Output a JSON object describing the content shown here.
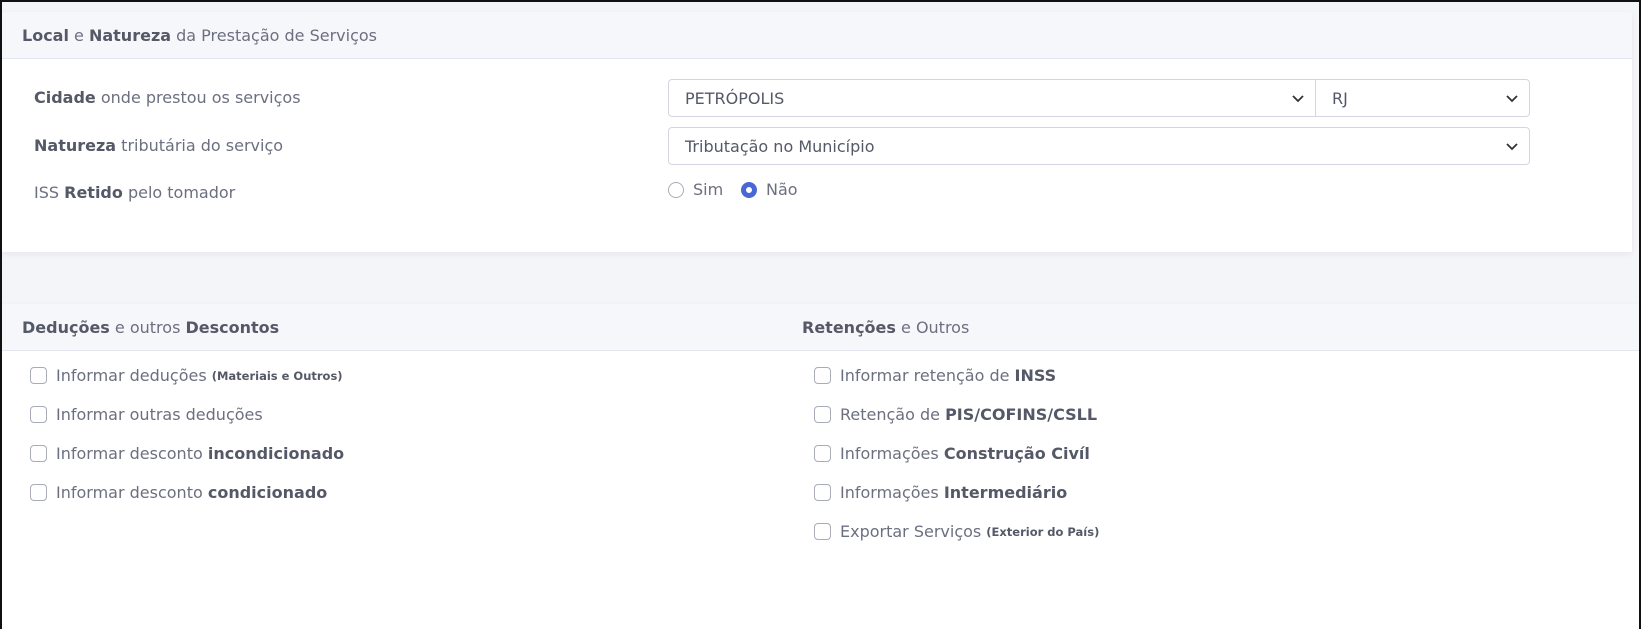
{
  "local_section": {
    "header": {
      "b1": "Local",
      "t1": " e ",
      "b2": "Natureza",
      "t2": " da Prestação de Serviços"
    },
    "city": {
      "label_bold": "Cidade",
      "label_rest": " onde prestou os serviços",
      "value": "PETRÓPOLIS",
      "state": "RJ"
    },
    "nature": {
      "label_bold": "Natureza",
      "label_rest": " tributária do serviço",
      "value": "Tributação no Município"
    },
    "iss": {
      "label_pre": "ISS ",
      "label_bold": "Retido",
      "label_rest": " pelo tomador",
      "options": [
        "Sim",
        "Não"
      ],
      "selected": "Não"
    }
  },
  "deductions": {
    "header": {
      "b1": "Deduções",
      "t1": " e outros ",
      "b2": "Descontos"
    },
    "items": [
      {
        "text": "Informar deduções",
        "bold": "",
        "small": "(Materiais e Outros)"
      },
      {
        "text": "Informar outras deduções",
        "bold": "",
        "small": ""
      },
      {
        "text": "Informar desconto ",
        "bold": "incondicionado",
        "small": ""
      },
      {
        "text": "Informar desconto ",
        "bold": "condicionado",
        "small": ""
      }
    ]
  },
  "retentions": {
    "header": {
      "b1": "Retenções",
      "t1": " e Outros"
    },
    "items": [
      {
        "text": "Informar retenção de ",
        "bold": "INSS",
        "small": ""
      },
      {
        "text": "Retenção de ",
        "bold": "PIS/COFINS/CSLL",
        "small": ""
      },
      {
        "text": "Informações ",
        "bold": "Construção Civíl",
        "small": ""
      },
      {
        "text": "Informações ",
        "bold": "Intermediário",
        "small": ""
      },
      {
        "text": "Exportar Serviços",
        "bold": "",
        "small": "(Exterior do País)"
      }
    ]
  }
}
